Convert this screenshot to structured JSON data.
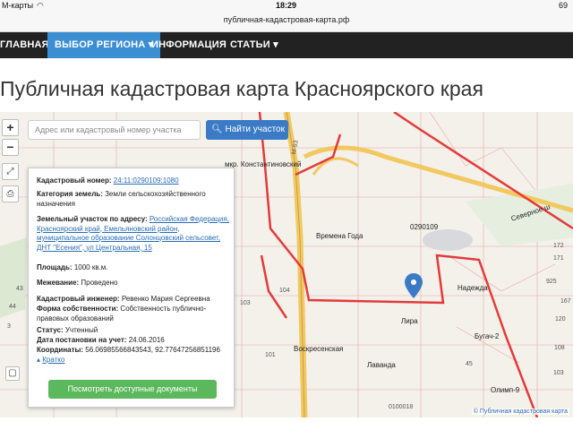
{
  "status_bar": {
    "carrier": "М-карты",
    "time": "18:29",
    "battery": "69"
  },
  "browser": {
    "url": "публичная-кадастровая-карта.рф"
  },
  "nav": {
    "items": [
      {
        "label": "ГЛАВНАЯ"
      },
      {
        "label": "ВЫБОР РЕГИОНА",
        "active": true
      },
      {
        "label": "ИНФОРМАЦИЯ"
      },
      {
        "label": "СТАТЬИ"
      }
    ]
  },
  "page_title": "Публичная кадастровая карта Красноярского края",
  "search": {
    "placeholder": "Адрес или кадастровый номер участка",
    "button_label": "Найти участок"
  },
  "map_controls": {
    "zoom_in": "+",
    "zoom_out": "−"
  },
  "popup": {
    "cadastral_number_label": "Кадастровый номер:",
    "cadastral_number_value": "24:11:0290109:1080",
    "land_category_label": "Категория земель:",
    "land_category_value": "Земли сельскохозяйственного назначения",
    "address_label": "Земельный участок по адресу:",
    "address_value": "Российская Федерация, Красноярский край, Емельяновский район, муниципальное образование Солонцовский сельсовет, ДНТ \"Есения\", ул Центральная, 15",
    "area_label": "Площадь:",
    "area_value": "1000 кв.м.",
    "survey_label": "Межевание:",
    "survey_value": "Проведено",
    "engineer_label": "Кадастровый инженер:",
    "engineer_value": "Ревенко Мария Сергеевна",
    "ownership_label": "Форма собственности:",
    "ownership_value": "Собственность публично-правовых образований",
    "status_label": "Статус:",
    "status_value": "Учтенный",
    "registration_date_label": "Дата постановки на учет:",
    "registration_date_value": "24.06.2016",
    "coordinates_label": "Координаты:",
    "coordinates_value": "56.06985566843543, 92.77647256851196",
    "collapse_link": "Кратко",
    "documents_button": "Посмотреть доступные документы"
  },
  "map_labels": {
    "village": "мкр. Константиновский",
    "vremena_goda": "Времена Года",
    "parcel_0290109": "0290109",
    "nadezhda": "Надежда",
    "lira": "Лира",
    "voskresenskaya": "Воскресенская",
    "lavanda": "Лаванда",
    "bugach": "Бугач-2",
    "olimp": "Олимп-9",
    "parcel_0100018": "0100018",
    "severnoe": "Северное ш",
    "road_m53": "М-53",
    "n_925": "925",
    "n_104": "104",
    "n_103": "103",
    "n_101": "101",
    "n_172": "172",
    "n_171": "171",
    "n_167": "167",
    "n_120": "120",
    "n_108": "108",
    "n_103b": "103",
    "n_45": "45",
    "n_43": "43",
    "n_44": "44",
    "n_3": "3"
  },
  "attribution": "© Публичная кадастровая карта",
  "colors": {
    "nav_bg": "#222222",
    "accent": "#3b8ed2",
    "boundary": "#e33b3b",
    "green_button": "#5cb85c"
  }
}
